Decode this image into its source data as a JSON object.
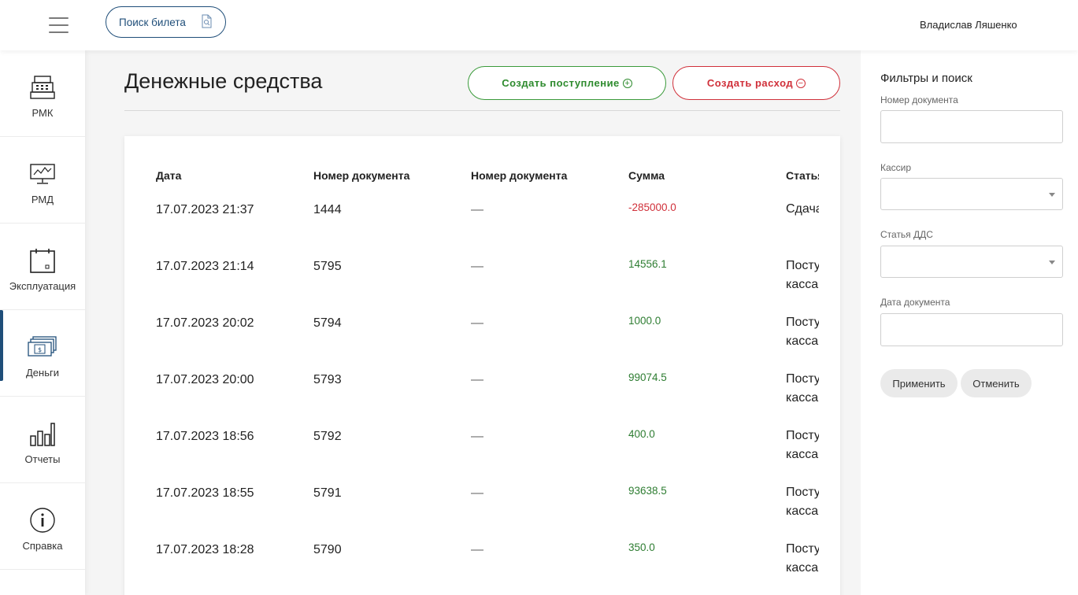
{
  "header": {
    "ticket_search_label": "Поиск билета",
    "user_name": "Владислав Ляшенко"
  },
  "sidebar": {
    "items": [
      {
        "label": "РМК",
        "icon": "cash-register-icon",
        "active": false
      },
      {
        "label": "РМД",
        "icon": "monitor-chart-icon",
        "active": false
      },
      {
        "label": "Эксплуатация",
        "icon": "calendar-icon",
        "active": false
      },
      {
        "label": "Деньги",
        "icon": "money-icon",
        "active": true
      },
      {
        "label": "Отчеты",
        "icon": "bar-chart-icon",
        "active": false
      },
      {
        "label": "Справка",
        "icon": "info-icon",
        "active": false
      }
    ],
    "active_color": "#1f4e79"
  },
  "main": {
    "title": "Денежные средства",
    "create_income_label": "Создать поступление",
    "create_expense_label": "Создать расход",
    "income_color": "#2e8b2e",
    "expense_color": "#d0303a",
    "columns": [
      "Дата",
      "Номер документа",
      "Номер документа",
      "Сумма",
      "Статья"
    ],
    "rows": [
      {
        "date": "17.07.2023 21:37",
        "number": "1444",
        "number2": "—",
        "sum": "-285000.0",
        "sign": "neg",
        "article": "Сдача"
      },
      {
        "date": "17.07.2023 21:14",
        "number": "5795",
        "number2": "—",
        "sum": "14556.1",
        "sign": "pos",
        "article": "Поступ касса"
      },
      {
        "date": "17.07.2023 20:02",
        "number": "5794",
        "number2": "—",
        "sum": "1000.0",
        "sign": "pos",
        "article": "Поступ касса"
      },
      {
        "date": "17.07.2023 20:00",
        "number": "5793",
        "number2": "—",
        "sum": "99074.5",
        "sign": "pos",
        "article": "Поступ касса"
      },
      {
        "date": "17.07.2023 18:56",
        "number": "5792",
        "number2": "—",
        "sum": "400.0",
        "sign": "pos",
        "article": "Поступ касса"
      },
      {
        "date": "17.07.2023 18:55",
        "number": "5791",
        "number2": "—",
        "sum": "93638.5",
        "sign": "pos",
        "article": "Поступ касса"
      },
      {
        "date": "17.07.2023 18:28",
        "number": "5790",
        "number2": "—",
        "sum": "350.0",
        "sign": "pos",
        "article": "Поступ касса"
      }
    ]
  },
  "filters": {
    "title": "Фильтры и поиск",
    "doc_number_label": "Номер документа",
    "doc_number_value": "",
    "cashier_label": "Кассир",
    "cashier_value": "",
    "dds_label": "Статья ДДС",
    "dds_value": "",
    "doc_date_label": "Дата документа",
    "doc_date_value": "",
    "apply_label": "Применить",
    "cancel_label": "Отменить"
  }
}
